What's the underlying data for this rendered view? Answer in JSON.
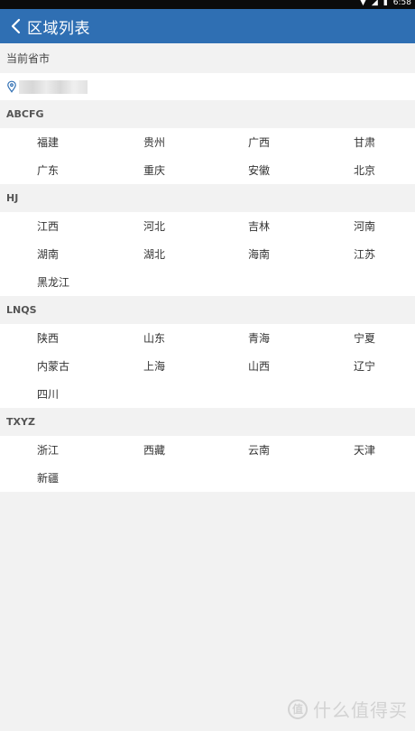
{
  "status": {
    "time": "6:58",
    "icons": [
      "signal-icon",
      "wifi-icon",
      "battery-icon"
    ]
  },
  "header": {
    "title": "区域列表"
  },
  "current": {
    "label": "当前省市"
  },
  "groups": [
    {
      "title": "ABCFG",
      "items": [
        "福建",
        "贵州",
        "广西",
        "甘肃",
        "广东",
        "重庆",
        "安徽",
        "北京"
      ]
    },
    {
      "title": "HJ",
      "items": [
        "江西",
        "河北",
        "吉林",
        "河南",
        "湖南",
        "湖北",
        "海南",
        "江苏",
        "黑龙江"
      ]
    },
    {
      "title": "LNQS",
      "items": [
        "陕西",
        "山东",
        "青海",
        "宁夏",
        "内蒙古",
        "上海",
        "山西",
        "辽宁",
        "四川"
      ]
    },
    {
      "title": "TXYZ",
      "items": [
        "浙江",
        "西藏",
        "云南",
        "天津",
        "新疆"
      ]
    }
  ],
  "watermark": {
    "text": "什么值得买",
    "icon": "值"
  },
  "colors": {
    "app_bar": "#2f6fb3",
    "background": "#f2f2f2",
    "surface": "#ffffff"
  }
}
